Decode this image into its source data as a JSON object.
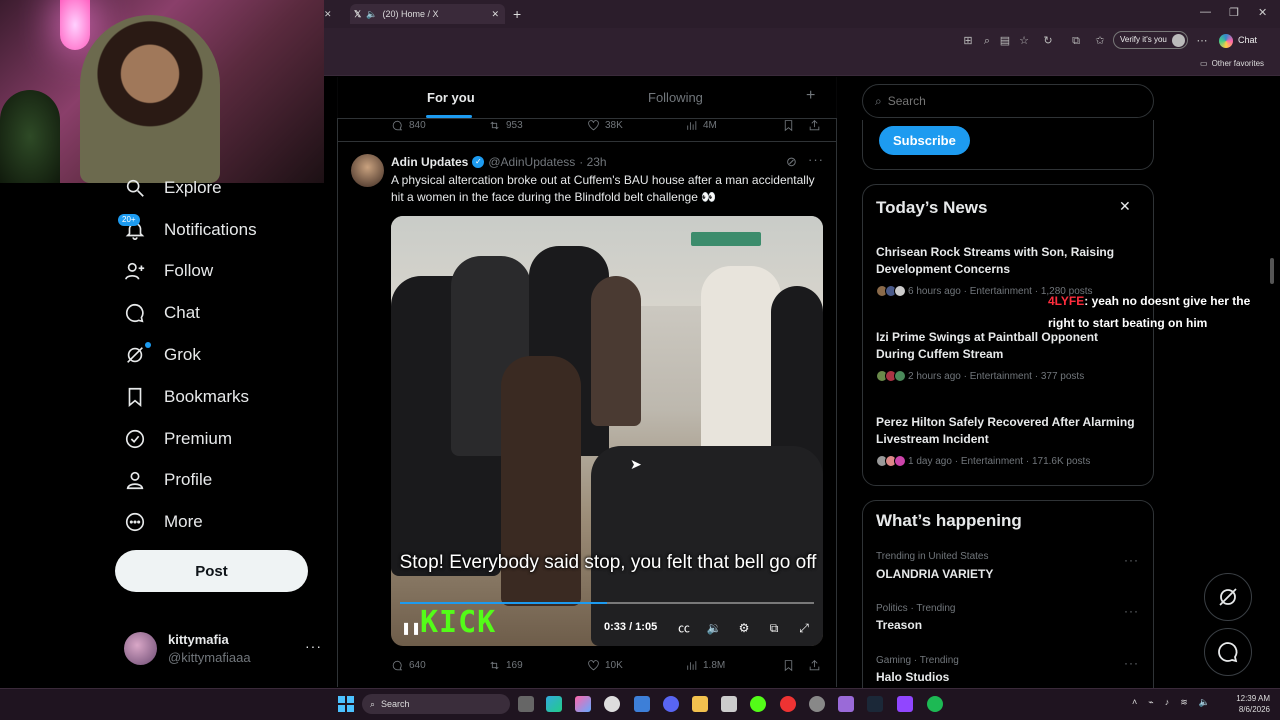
{
  "browser": {
    "tab_title": "(20) Home / X",
    "verify_label": "Verify it's you",
    "chat_label": "Chat",
    "favorites_label": "Other favorites"
  },
  "nav": {
    "items": [
      {
        "label": "Explore",
        "icon": "search-icon"
      },
      {
        "label": "Notifications",
        "icon": "bell-icon"
      },
      {
        "label": "Follow",
        "icon": "person-add-icon"
      },
      {
        "label": "Chat",
        "icon": "chat-icon"
      },
      {
        "label": "Grok",
        "icon": "grok-icon"
      },
      {
        "label": "Bookmarks",
        "icon": "bookmark-icon"
      },
      {
        "label": "Premium",
        "icon": "verified-icon"
      },
      {
        "label": "Profile",
        "icon": "person-icon"
      },
      {
        "label": "More",
        "icon": "more-circle-icon"
      }
    ],
    "notif_badge": "20+",
    "post_label": "Post",
    "account": {
      "name": "kittymafia",
      "handle": "@kittymafiaaa"
    }
  },
  "feed": {
    "tabs": {
      "for_you": "For you",
      "following": "Following"
    },
    "plus": "+",
    "prev_actions": {
      "replies": "840",
      "reposts": "953",
      "likes": "38K",
      "views": "4M"
    },
    "tweet": {
      "author": "Adin Updates",
      "handle": "@AdinUpdatess",
      "time": "· 23h",
      "text": "A physical altercation broke out at Cuffem's BAU house after a man accidentally hit a women in the face during the Blindfold belt challenge 👀",
      "video": {
        "caption": "Stop! Everybody said stop, you felt that bell go off",
        "watermark": "KICK",
        "time": "0:33 / 1:05",
        "progress": 0.5
      },
      "actions": {
        "replies": "640",
        "reposts": "169",
        "likes": "10K",
        "views": "1.8M"
      }
    }
  },
  "right": {
    "search_placeholder": "Search",
    "subscribe_label": "Subscribe",
    "news": {
      "title": "Today’s News",
      "items": [
        {
          "title": "Chrisean Rock Streams with Son, Raising Development Concerns",
          "meta": "6 hours ago · Entertainment · 1,280 posts"
        },
        {
          "title": "Izi Prime Swings at Paintball Opponent During Cuffem Stream",
          "meta": "2 hours ago · Entertainment · 377 posts"
        },
        {
          "title": "Perez Hilton Safely Recovered After Alarming Livestream Incident",
          "meta": "1 day ago · Entertainment · 171.6K posts"
        }
      ]
    },
    "happening": {
      "title": "What’s happening",
      "items": [
        {
          "context": "Trending in United States",
          "name": "OLANDRIA VARIETY"
        },
        {
          "context": "Politics · Trending",
          "name": "Treason"
        },
        {
          "context": "Gaming · Trending",
          "name": "Halo Studios"
        }
      ]
    }
  },
  "stream_chat": {
    "user": "4LYFE",
    "message": ": yeah no doesnt give her the right to start beating on him"
  },
  "taskbar": {
    "search_label": "Search",
    "time": "12:39 AM",
    "date": "8/6/2026"
  },
  "colors": {
    "accent": "#1d9bf0",
    "background": "#000000",
    "kick_green": "#53fc18",
    "chat_user": "#ff2d3d"
  }
}
